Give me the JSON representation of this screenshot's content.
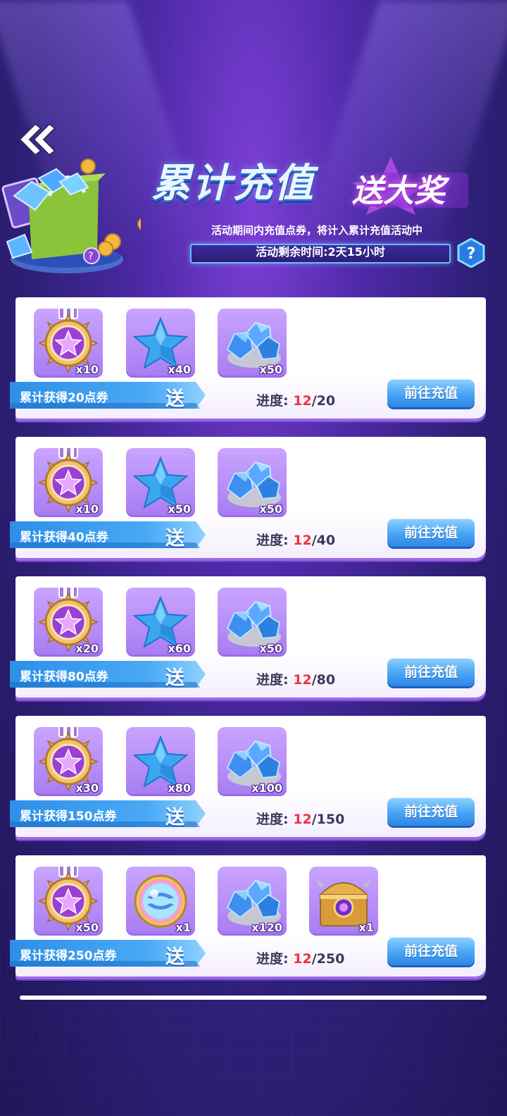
{
  "header": {
    "title": "累计充值",
    "title_sub": "送大奖",
    "description": "活动期间内充值点券，将计入累计充值活动中",
    "timer_label": "活动剩余时间:",
    "timer_value": "2天15小时",
    "help_glyph": "?"
  },
  "tiers": [
    {
      "label": "累计获得20点券",
      "send": "送",
      "progress_label": "进度:",
      "progress_current": "12",
      "progress_total": "/20",
      "button": "前往充值",
      "items": [
        {
          "icon": "star-medal-icon",
          "qty": "x10"
        },
        {
          "icon": "blue-star-icon",
          "qty": "x40"
        },
        {
          "icon": "blue-gems-icon",
          "qty": "x50"
        }
      ]
    },
    {
      "label": "累计获得40点券",
      "send": "送",
      "progress_label": "进度:",
      "progress_current": "12",
      "progress_total": "/40",
      "button": "前往充值",
      "items": [
        {
          "icon": "star-medal-icon",
          "qty": "x10"
        },
        {
          "icon": "blue-star-icon",
          "qty": "x50"
        },
        {
          "icon": "blue-gems-icon",
          "qty": "x50"
        }
      ]
    },
    {
      "label": "累计获得80点券",
      "send": "送",
      "progress_label": "进度:",
      "progress_current": "12",
      "progress_total": "/80",
      "button": "前往充值",
      "items": [
        {
          "icon": "star-medal-icon",
          "qty": "x20"
        },
        {
          "icon": "blue-star-icon",
          "qty": "x60"
        },
        {
          "icon": "blue-gems-icon",
          "qty": "x50"
        }
      ]
    },
    {
      "label": "累计获得150点券",
      "send": "送",
      "progress_label": "进度:",
      "progress_current": "12",
      "progress_total": "/150",
      "button": "前往充值",
      "items": [
        {
          "icon": "star-medal-icon",
          "qty": "x30"
        },
        {
          "icon": "blue-star-icon",
          "qty": "x80"
        },
        {
          "icon": "blue-gems-icon",
          "qty": "x100"
        }
      ]
    },
    {
      "label": "累计获得250点券",
      "send": "送",
      "progress_label": "进度:",
      "progress_current": "12",
      "progress_total": "/250",
      "button": "前往充值",
      "items": [
        {
          "icon": "star-medal-icon",
          "qty": "x50"
        },
        {
          "icon": "rainbow-orb-icon",
          "qty": "x1"
        },
        {
          "icon": "blue-gems-icon",
          "qty": "x120"
        },
        {
          "icon": "treasure-chest-icon",
          "qty": "x1"
        }
      ]
    }
  ],
  "colors": {
    "accent_blue": "#47a4f4",
    "progress_current": "#f0313d",
    "card_shadow": "#9a6ae6"
  }
}
